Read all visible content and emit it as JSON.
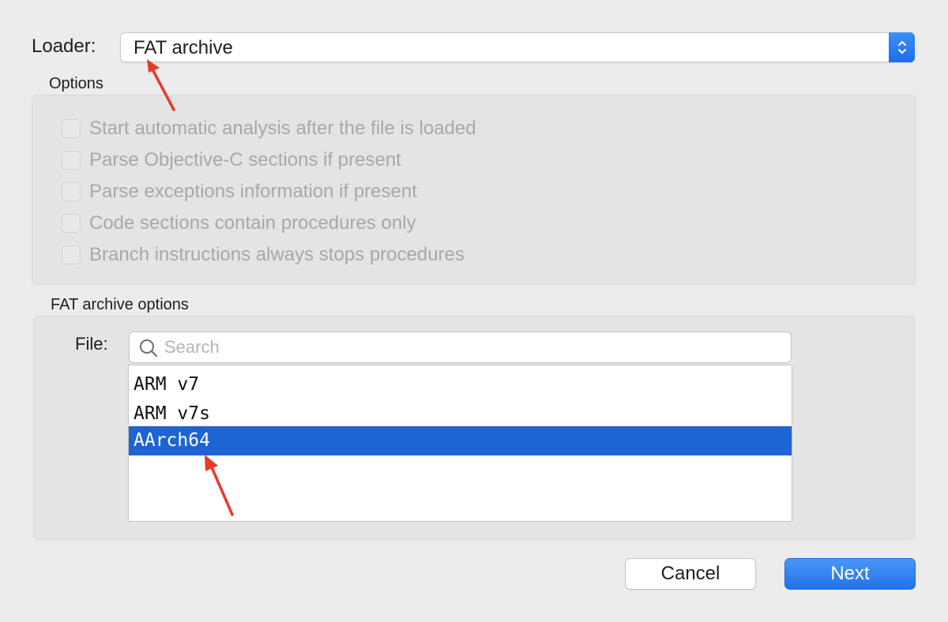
{
  "loader": {
    "label": "Loader:",
    "selected": "FAT archive"
  },
  "options": {
    "title": "Options",
    "items": [
      {
        "label": "Start automatic analysis after the file is loaded",
        "checked": false,
        "enabled": false
      },
      {
        "label": "Parse Objective-C sections if present",
        "checked": false,
        "enabled": false
      },
      {
        "label": "Parse exceptions information if present",
        "checked": false,
        "enabled": false
      },
      {
        "label": "Code sections contain procedures only",
        "checked": false,
        "enabled": false
      },
      {
        "label": "Branch instructions always stops procedures",
        "checked": false,
        "enabled": false
      }
    ]
  },
  "fat": {
    "title": "FAT archive options",
    "file_label": "File:",
    "search_placeholder": "Search",
    "search_value": "",
    "files": [
      "ARM v7",
      "ARM v7s",
      "AArch64"
    ],
    "selected_file": "AArch64"
  },
  "buttons": {
    "cancel": "Cancel",
    "next": "Next"
  },
  "colors": {
    "accent": "#1e64d2",
    "annotation_arrow": "#e8392c"
  },
  "icons": {
    "search": "search-icon",
    "stepper": "chevron-up-down-icon"
  }
}
